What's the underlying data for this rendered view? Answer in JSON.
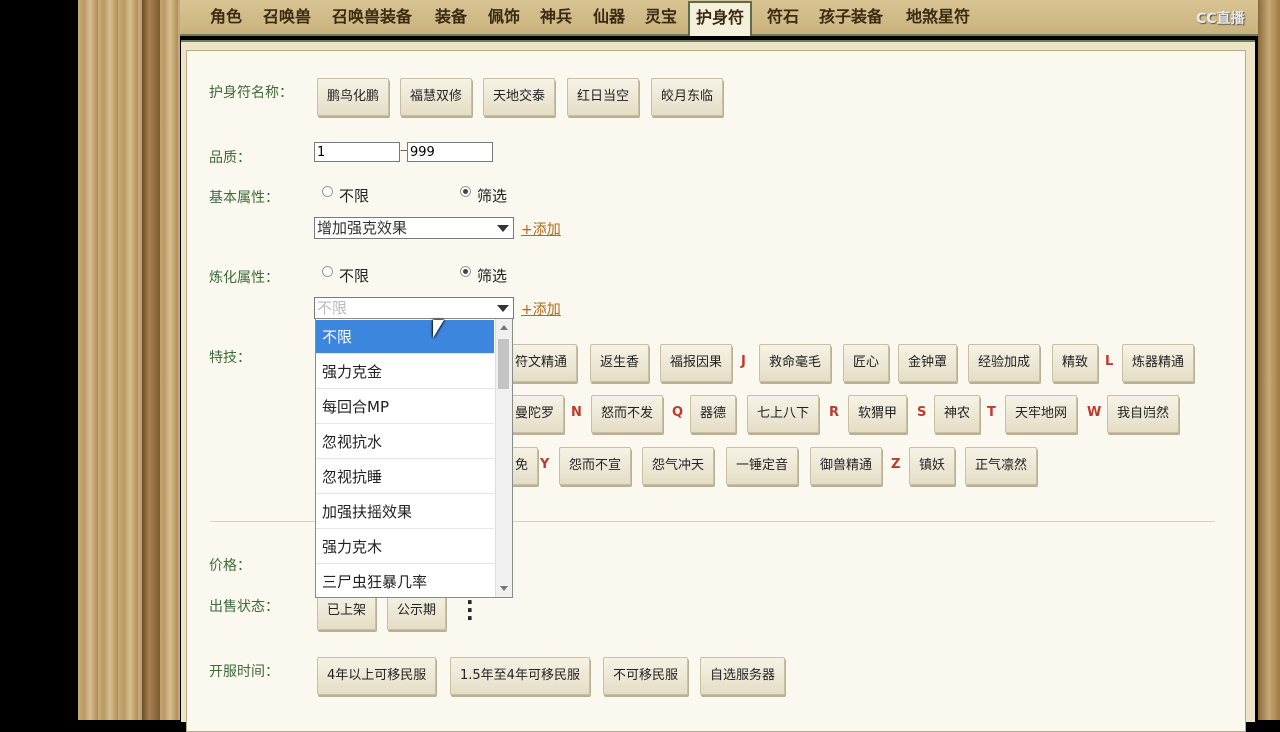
{
  "tabs": [
    {
      "label": "角色"
    },
    {
      "label": "召唤兽"
    },
    {
      "label": "召唤兽装备"
    },
    {
      "label": "装备"
    },
    {
      "label": "佩饰"
    },
    {
      "label": "神兵"
    },
    {
      "label": "仙器"
    },
    {
      "label": "灵宝"
    },
    {
      "label": "护身符",
      "active": true
    },
    {
      "label": "符石"
    },
    {
      "label": "孩子装备"
    },
    {
      "label": "地煞星符"
    }
  ],
  "watermark": "CC直播",
  "amulet_name": {
    "label": "护身符名称：",
    "options": [
      "鹏鸟化鹏",
      "福慧双修",
      "天地交泰",
      "红日当空",
      "皎月东临"
    ]
  },
  "quality": {
    "label": "品质：",
    "min": "1",
    "separator": "—",
    "max": "999"
  },
  "basic_attr": {
    "label": "基本属性：",
    "radio_unlimited": "不限",
    "radio_filter": "筛选",
    "selected_value": "增加强克效果",
    "add_link": "+添加"
  },
  "refine_attr": {
    "label": "炼化属性：",
    "radio_unlimited": "不限",
    "radio_filter": "筛选",
    "placeholder": "不限",
    "add_link": "+添加"
  },
  "dropdown_options": [
    "不限",
    "强力克金",
    "每回合MP",
    "忽视抗水",
    "忽视抗睡",
    "加强扶摇效果",
    "强力克木",
    "三尸虫狂暴几率"
  ],
  "skills": {
    "label": "特技：",
    "row1": {
      "b1": "符文精通",
      "b2": "返生香",
      "b3": "福报因果",
      "l1": "J",
      "b4": "救命毫毛",
      "b5": "匠心",
      "b6": "金钟罩",
      "b7": "经验加成",
      "b8": "精致",
      "l2": "L",
      "b9": "炼器精通"
    },
    "row2": {
      "b1": "曼陀罗",
      "l1": "N",
      "b2": "怒而不发",
      "l2": "Q",
      "b3": "器德",
      "b4": "七上八下",
      "l3": "R",
      "b5": "软猬甲",
      "l4": "S",
      "b6": "神农",
      "l5": "T",
      "b7": "天牢地网",
      "l6": "W",
      "b8": "我自岿然"
    },
    "row3": {
      "b1": "免",
      "l1": "Y",
      "b2": "怨而不宣",
      "b3": "怨气冲天",
      "b4": "一锤定音",
      "b5": "御兽精通",
      "l2": "Z",
      "b6": "镇妖",
      "b7": "正气凛然"
    }
  },
  "price": {
    "label": "价格："
  },
  "sale_status": {
    "label": "出售状态：",
    "b1": "已上架",
    "b2": "公示期"
  },
  "open_time": {
    "label": "开服时间：",
    "b1": "4年以上可移民服",
    "b2": "1.5年至4年可移民服",
    "b3": "不可移民服",
    "b4": "自选服务器"
  }
}
